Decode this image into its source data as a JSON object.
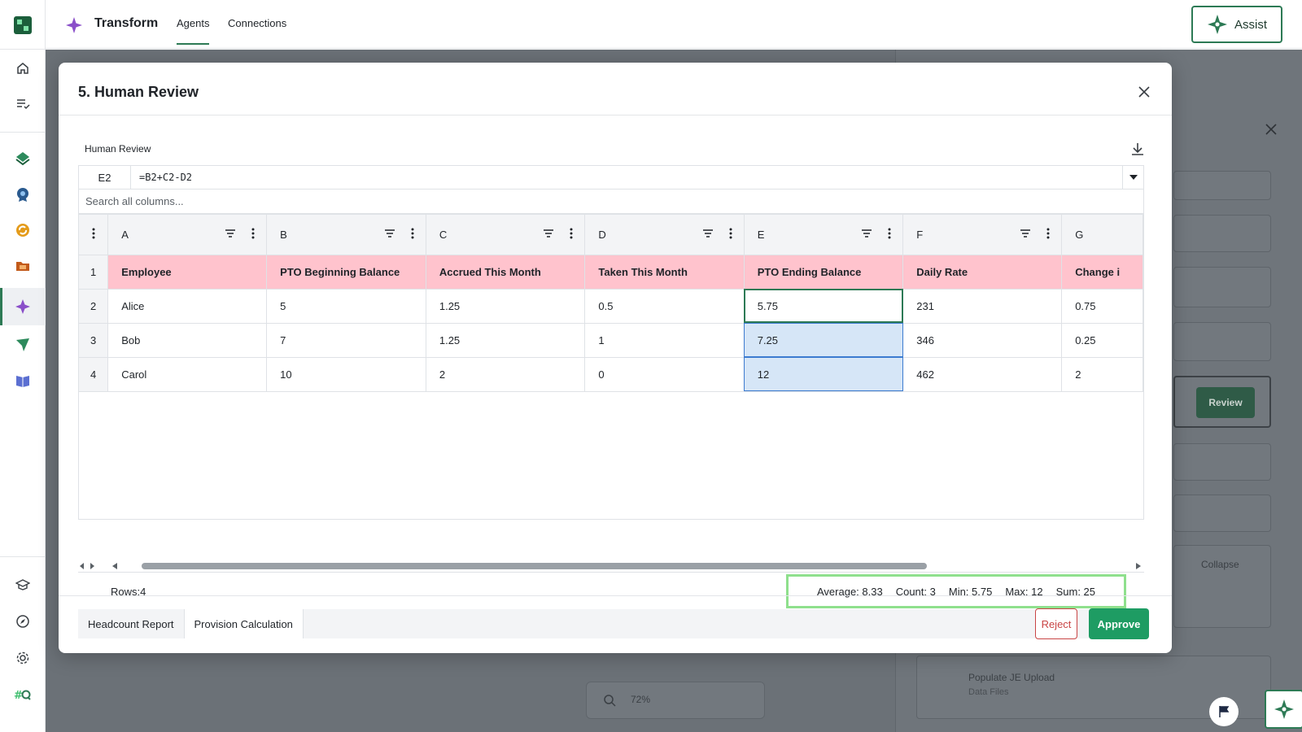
{
  "topbar": {
    "app_title": "Transform",
    "tabs": [
      {
        "label": "Agents",
        "active": true
      },
      {
        "label": "Connections",
        "active": false
      }
    ],
    "assist_label": "Assist"
  },
  "background": {
    "review_label": "Review",
    "collapse_label": "Collapse",
    "populate_title": "Populate JE Upload",
    "populate_subtitle": "Data Files",
    "zoom_level": "72%"
  },
  "modal": {
    "title": "5. Human Review",
    "section_label": "Human Review",
    "formula": {
      "cell_ref": "E2",
      "value": "=B2+C2-D2"
    },
    "search_placeholder": "Search all columns...",
    "columns": [
      "A",
      "B",
      "C",
      "D",
      "E",
      "F",
      "G"
    ],
    "rows": [
      {
        "num": "1",
        "cells": [
          "Employee",
          "PTO Beginning Balance",
          "Accrued This Month",
          "Taken This Month",
          "PTO Ending Balance",
          "Daily Rate",
          "Change i"
        ]
      },
      {
        "num": "2",
        "cells": [
          "Alice",
          "5",
          "1.25",
          "0.5",
          "5.75",
          "231",
          "0.75"
        ]
      },
      {
        "num": "3",
        "cells": [
          "Bob",
          "7",
          "1.25",
          "1",
          "7.25",
          "346",
          "0.25"
        ]
      },
      {
        "num": "4",
        "cells": [
          "Carol",
          "10",
          "2",
          "0",
          "12",
          "462",
          "2"
        ]
      }
    ],
    "status": {
      "rows": "Rows:4",
      "average": "Average: 8.33",
      "count": "Count: 3",
      "min": "Min: 5.75",
      "max": "Max: 12",
      "sum": "Sum: 25"
    },
    "sheet_tabs": [
      {
        "label": "Headcount Report",
        "active": false
      },
      {
        "label": "Provision Calculation",
        "active": true
      }
    ],
    "reject_label": "Reject",
    "approve_label": "Approve"
  },
  "colors": {
    "accent": "#2d7a55",
    "approve": "#1e9c63",
    "reject": "#c94545",
    "header_row": "#ffc3cd",
    "selection": "#d6e6f7",
    "stats_highlight": "#8fe08d"
  },
  "icons": [
    "app-logo-icon",
    "home-icon",
    "tasks-icon",
    "layers-icon",
    "badge-icon",
    "sync-icon",
    "folder-icon",
    "sparkle-icon",
    "send-icon",
    "book-icon",
    "learn-icon",
    "compass-icon",
    "gear-icon",
    "hashq-icon",
    "close-icon",
    "download-icon",
    "filter-icon",
    "kebab-icon",
    "flag-icon"
  ]
}
